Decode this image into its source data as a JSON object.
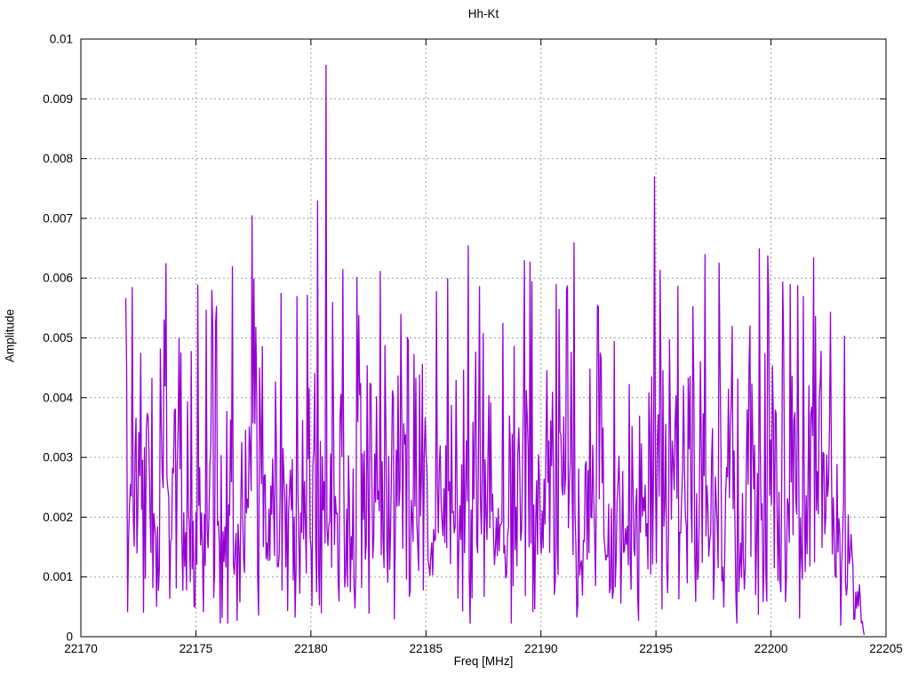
{
  "figure": {
    "background_color": "#ffffff",
    "border_color": "#000000",
    "grid_color": "#9c9c9c",
    "text_color": "#000000"
  },
  "chart_data": {
    "type": "line",
    "title": "Hh-Kt",
    "xlabel": "Freq [MHz]",
    "ylabel": "Amplitude",
    "xlim": [
      22170,
      22205
    ],
    "ylim": [
      0,
      0.01
    ],
    "x_ticks": [
      22170,
      22175,
      22180,
      22185,
      22190,
      22195,
      22200,
      22205
    ],
    "x_tick_labels": [
      "22170",
      "22175",
      "22180",
      "22185",
      "22190",
      "22195",
      "22200",
      "22205"
    ],
    "y_ticks": [
      0,
      0.001,
      0.002,
      0.003,
      0.004,
      0.005,
      0.006,
      0.007,
      0.008,
      0.009,
      0.01
    ],
    "y_tick_labels": [
      "0",
      "0.001",
      "0.002",
      "0.003",
      "0.004",
      "0.005",
      "0.006",
      "0.007",
      "0.008",
      "0.009",
      "0.01"
    ],
    "grid": "dashed-major",
    "legend": "none",
    "series": [
      {
        "name": "Hh-Kt",
        "color": "#9400d3",
        "style": "lines",
        "x_start": 22171.95,
        "x_end": 22204.05,
        "n_points": 790,
        "mean_level": 0.0024,
        "noise_model": {
          "distribution": "rayleigh",
          "seed": 7,
          "sigma": 0.0019,
          "min_amplitude": 0.00022,
          "soft_cap": 0.0058,
          "soft_cap_factor": 0.3,
          "tail_taper_start": 22203.0,
          "tail_end_factor": 0.02
        },
        "peaks": [
          {
            "x": 22172.25,
            "y": 0.00585
          },
          {
            "x": 22172.6,
            "y": 0.00475
          },
          {
            "x": 22173.7,
            "y": 0.00625
          },
          {
            "x": 22174.25,
            "y": 0.005
          },
          {
            "x": 22174.8,
            "y": 0.00478
          },
          {
            "x": 22175.45,
            "y": 0.00547
          },
          {
            "x": 22175.85,
            "y": 0.00525
          },
          {
            "x": 22176.6,
            "y": 0.0062
          },
          {
            "x": 22177.45,
            "y": 0.00705
          },
          {
            "x": 22177.9,
            "y": 0.00486
          },
          {
            "x": 22178.7,
            "y": 0.00575
          },
          {
            "x": 22179.4,
            "y": 0.0057
          },
          {
            "x": 22179.85,
            "y": 0.00572
          },
          {
            "x": 22180.3,
            "y": 0.0073
          },
          {
            "x": 22180.65,
            "y": 0.00957
          },
          {
            "x": 22180.95,
            "y": 0.0056
          },
          {
            "x": 22181.4,
            "y": 0.00615
          },
          {
            "x": 22182.1,
            "y": 0.00538
          },
          {
            "x": 22183.0,
            "y": 0.00612
          },
          {
            "x": 22183.9,
            "y": 0.0054
          },
          {
            "x": 22184.5,
            "y": 0.00473
          },
          {
            "x": 22185.45,
            "y": 0.00578
          },
          {
            "x": 22185.95,
            "y": 0.006
          },
          {
            "x": 22186.85,
            "y": 0.00655
          },
          {
            "x": 22187.5,
            "y": 0.00508
          },
          {
            "x": 22188.35,
            "y": 0.00525
          },
          {
            "x": 22189.3,
            "y": 0.0063
          },
          {
            "x": 22190.65,
            "y": 0.0059
          },
          {
            "x": 22191.45,
            "y": 0.0066
          },
          {
            "x": 22192.5,
            "y": 0.00552
          },
          {
            "x": 22193.2,
            "y": 0.00495
          },
          {
            "x": 22194.95,
            "y": 0.0077
          },
          {
            "x": 22195.2,
            "y": 0.00614
          },
          {
            "x": 22195.95,
            "y": 0.00587
          },
          {
            "x": 22196.6,
            "y": 0.00553
          },
          {
            "x": 22197.15,
            "y": 0.0064
          },
          {
            "x": 22197.75,
            "y": 0.00626
          },
          {
            "x": 22198.3,
            "y": 0.0052
          },
          {
            "x": 22199.5,
            "y": 0.0065
          },
          {
            "x": 22199.85,
            "y": 0.00638
          },
          {
            "x": 22200.85,
            "y": 0.0059
          },
          {
            "x": 22201.4,
            "y": 0.0057
          },
          {
            "x": 22201.85,
            "y": 0.00635
          },
          {
            "x": 22202.6,
            "y": 0.00544
          }
        ]
      }
    ]
  }
}
